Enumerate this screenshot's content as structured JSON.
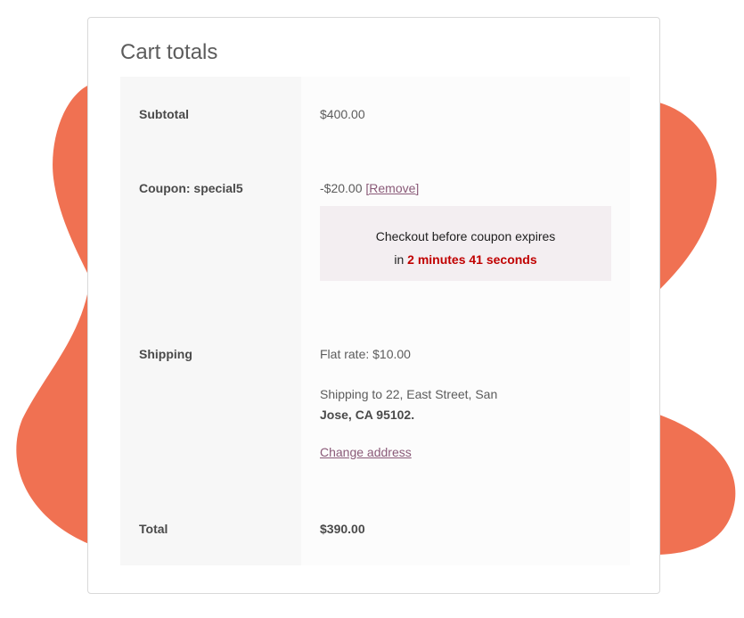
{
  "colors": {
    "blob": "#f07152",
    "link": "#8a5a78",
    "timer_accent": "#c00000",
    "timer_bg": "#f3eef1"
  },
  "card": {
    "title": "Cart totals"
  },
  "rows": {
    "subtotal": {
      "label": "Subtotal",
      "value": "$400.00"
    },
    "coupon": {
      "label": "Coupon: special5",
      "value": "-$20.00",
      "remove_label": "[Remove]",
      "timer_line1": "Checkout before coupon expires",
      "timer_prefix": "in",
      "timer_value": "2 minutes 41 seconds"
    },
    "shipping": {
      "label": "Shipping",
      "method": "Flat rate: $10.00",
      "destination_prefix": "Shipping to 22, East Street, San",
      "destination_bold": "Jose, CA 95102.",
      "change_label": "Change address"
    },
    "total": {
      "label": "Total",
      "value": "$390.00"
    }
  }
}
